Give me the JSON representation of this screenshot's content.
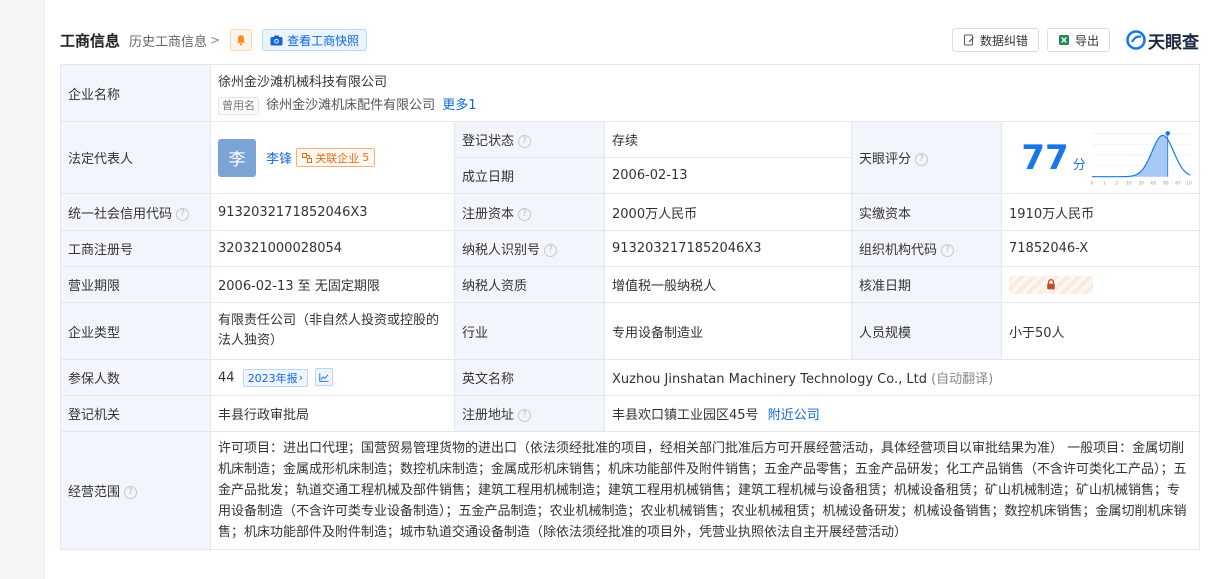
{
  "header": {
    "title": "工商信息",
    "history_link": "历史工商信息",
    "snapshot_button": "查看工商快照",
    "error_button": "数据纠错",
    "export_button": "导出",
    "brand": "天眼查"
  },
  "company": {
    "name_label": "企业名称",
    "name": "徐州金沙滩机械科技有限公司",
    "former_tag": "曾用名",
    "former_name": "徐州金沙滩机床配件有限公司",
    "former_more": "更多1"
  },
  "legal_rep": {
    "label": "法定代表人",
    "avatar_char": "李",
    "name": "李锋",
    "related_label": "关联企业",
    "related_count": "5"
  },
  "register_status": {
    "label": "登记状态",
    "value": "存续"
  },
  "found_date": {
    "label": "成立日期",
    "value": "2006-02-13"
  },
  "tianyan_score": {
    "label": "天眼评分",
    "value": "77",
    "unit": "分",
    "axis": [
      "0",
      "1",
      "3",
      "10",
      "30",
      "60",
      "80",
      "97",
      "100"
    ]
  },
  "credit_code": {
    "label": "统一社会信用代码",
    "value": "913203217185204 6X3"
  },
  "reg_capital": {
    "label": "注册资本",
    "value": "2000万人民币"
  },
  "paid_capital": {
    "label": "实缴资本",
    "value": "1910万人民币"
  },
  "reg_number": {
    "label": "工商注册号",
    "value": "320321000028054"
  },
  "taxpayer_id": {
    "label": "纳税人识别号",
    "value": "9132032171852046X3"
  },
  "org_code": {
    "label": "组织机构代码",
    "value": "71852046-X"
  },
  "biz_term": {
    "label": "营业期限",
    "value": "2006-02-13 至 无固定期限"
  },
  "taxpayer_qual": {
    "label": "纳税人资质",
    "value": "增值税一般纳税人"
  },
  "approve_date": {
    "label": "核准日期"
  },
  "company_type": {
    "label": "企业类型",
    "value": "有限责任公司（非自然人投资或控股的法人独资）"
  },
  "industry": {
    "label": "行业",
    "value": "专用设备制造业"
  },
  "staff_size": {
    "label": "人员规模",
    "value": "小于50人"
  },
  "insured": {
    "label": "参保人数",
    "value": "44",
    "year_tag": "2023年报"
  },
  "english_name": {
    "label": "英文名称",
    "value": "Xuzhou Jinshatan Machinery Technology Co., Ltd",
    "auto": "(自动翻译)"
  },
  "reg_authority": {
    "label": "登记机关",
    "value": "丰县行政审批局"
  },
  "reg_address": {
    "label": "注册地址",
    "value": "丰县欢口镇工业园区45号",
    "nearby": "附近公司"
  },
  "scope": {
    "label": "经营范围",
    "value": "许可项目：进出口代理；国营贸易管理货物的进出口（依法须经批准的项目，经相关部门批准后方可开展经营活动，具体经营项目以审批结果为准） 一般项目：金属切削机床制造；金属成形机床制造；数控机床制造；金属成形机床销售；机床功能部件及附件销售；五金产品零售；五金产品研发；化工产品销售（不含许可类化工产品）；五金产品批发；轨道交通工程机械及部件销售；建筑工程用机械制造；建筑工程用机械销售；建筑工程机械与设备租赁；机械设备租赁；矿山机械制造；矿山机械销售；专用设备制造（不含许可类专业设备制造）；五金产品制造；农业机械制造；农业机械销售；农业机械租赁；机械设备研发；机械设备销售；数控机床销售；金属切削机床销售；机床功能部件及附件制造；城市轨道交通设备制造（除依法须经批准的项目外，凭营业执照依法自主开展经营活动）"
  },
  "colors": {
    "accent": "#1167d9",
    "score": "#1878e6",
    "status_green": "#22a05a",
    "key_bg": "#f2f6fc"
  }
}
